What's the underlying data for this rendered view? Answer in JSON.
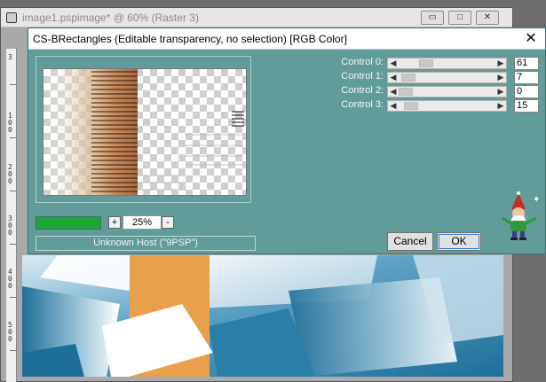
{
  "background_window": {
    "title": "image1.pspimage* @  60% (Raster 3)",
    "minimize_label": "▭",
    "maximize_label": "□",
    "close_label": "✕",
    "ruler_labels": [
      "3",
      "1\n0\n0",
      "2\n0\n0",
      "3\n0\n0",
      "4\n0\n0",
      "5\n0\n0"
    ]
  },
  "dialog": {
    "title": "CS-BRectangles (Editable transparency, no selection) [RGB Color]",
    "close_label": "✕",
    "zoom": {
      "minus_label": "-",
      "plus_label": "+",
      "value": "25%"
    },
    "progress": 1.0,
    "host_text": "Unknown Host (\"9PSP\")",
    "controls": [
      {
        "label": "Control 0:",
        "value": "61",
        "fraction": 0.24
      },
      {
        "label": "Control 1:",
        "value": "7",
        "fraction": 0.03
      },
      {
        "label": "Control 2:",
        "value": "0",
        "fraction": 0.0
      },
      {
        "label": "Control 3:",
        "value": "15",
        "fraction": 0.06
      }
    ],
    "buttons": {
      "cancel": "Cancel",
      "ok": "OK"
    }
  },
  "colors": {
    "dialog_bg": "#619c9a",
    "progress_fill": "#1da736",
    "canvas_orange": "#e9a04c",
    "canvas_blue": "#2a7ea8"
  }
}
